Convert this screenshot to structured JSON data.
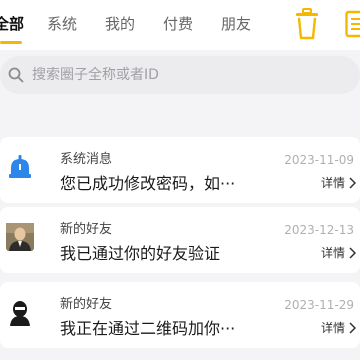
{
  "tabs": [
    {
      "label": "全部",
      "active": true
    },
    {
      "label": "系统",
      "active": false
    },
    {
      "label": "我的",
      "active": false
    },
    {
      "label": "付费",
      "active": false
    },
    {
      "label": "朋友",
      "active": false
    }
  ],
  "toolbar": {
    "icons": [
      "trash-icon",
      "list-icon"
    ],
    "accent_color": "#f5b700"
  },
  "search": {
    "placeholder": "搜索圈子全称或者ID",
    "value": ""
  },
  "messages": [
    {
      "title": "系统消息",
      "preview": "您已成功修改密码，如···",
      "date": "2023-11-09",
      "detail_label": "详情",
      "avatar": "bell-icon"
    },
    {
      "title": "新的好友",
      "preview": "我已通过你的好友验证",
      "date": "2023-12-13",
      "detail_label": "详情",
      "avatar": "user-photo"
    },
    {
      "title": "新的好友",
      "preview": "我正在通过二维码加你···",
      "date": "2023-11-29",
      "detail_label": "详情",
      "avatar": "user-photo"
    }
  ]
}
